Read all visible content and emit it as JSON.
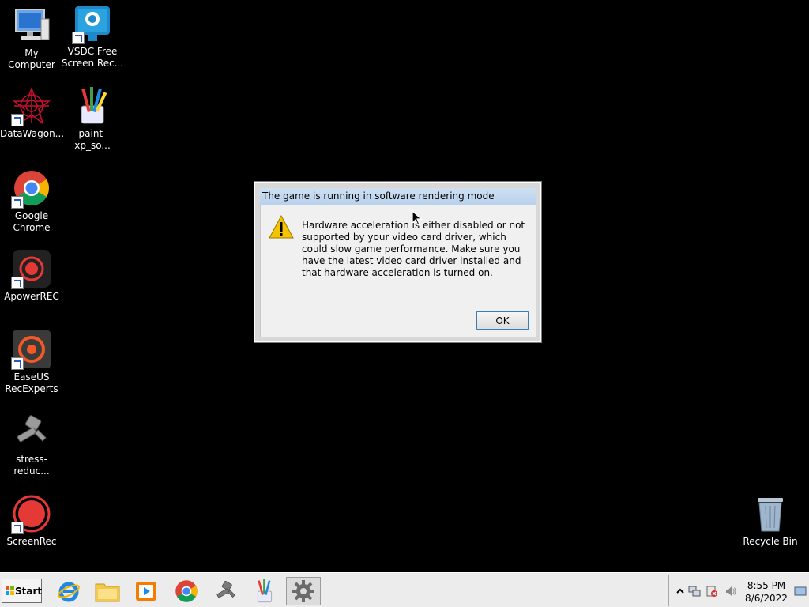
{
  "desktop": {
    "icons": [
      {
        "label": "My Computer",
        "icon": "computer-icon"
      },
      {
        "label": "VSDC Free Screen Rec...",
        "icon": "vsdc-icon"
      },
      {
        "label": "DataWagon...",
        "icon": "datawagon-icon"
      },
      {
        "label": "paint-xp_so...",
        "icon": "paint-icon"
      },
      {
        "label": "Google Chrome",
        "icon": "chrome-icon"
      },
      {
        "label": "ApowerREC",
        "icon": "apowerrec-icon"
      },
      {
        "label": "EaseUS RecExperts",
        "icon": "easeus-icon"
      },
      {
        "label": "stress-reduc...",
        "icon": "stress-icon"
      },
      {
        "label": "ScreenRec",
        "icon": "screenrec-icon"
      },
      {
        "label": "Recycle Bin",
        "icon": "recycle-bin-icon"
      }
    ]
  },
  "dialog": {
    "title": "The game is running in software rendering mode",
    "message": "Hardware acceleration is either disabled or not supported by your video card driver, which could slow game performance. Make sure you have the latest video card driver installed and that hardware acceleration is turned on.",
    "ok_label": "OK"
  },
  "taskbar": {
    "start_label": "Start",
    "apps": [
      "internet-explorer-icon",
      "file-explorer-icon",
      "media-player-icon",
      "chrome-icon",
      "stress-icon",
      "paint-icon",
      "game-gear-icon"
    ],
    "clock": {
      "time": "8:55 PM",
      "date": "8/6/2022"
    }
  },
  "colors": {
    "desktop": "#000000",
    "warning": "#f5c400",
    "chrome_red": "#db4437",
    "chrome_green": "#0f9d58",
    "chrome_yellow": "#f4b400",
    "chrome_blue": "#4285f4"
  }
}
